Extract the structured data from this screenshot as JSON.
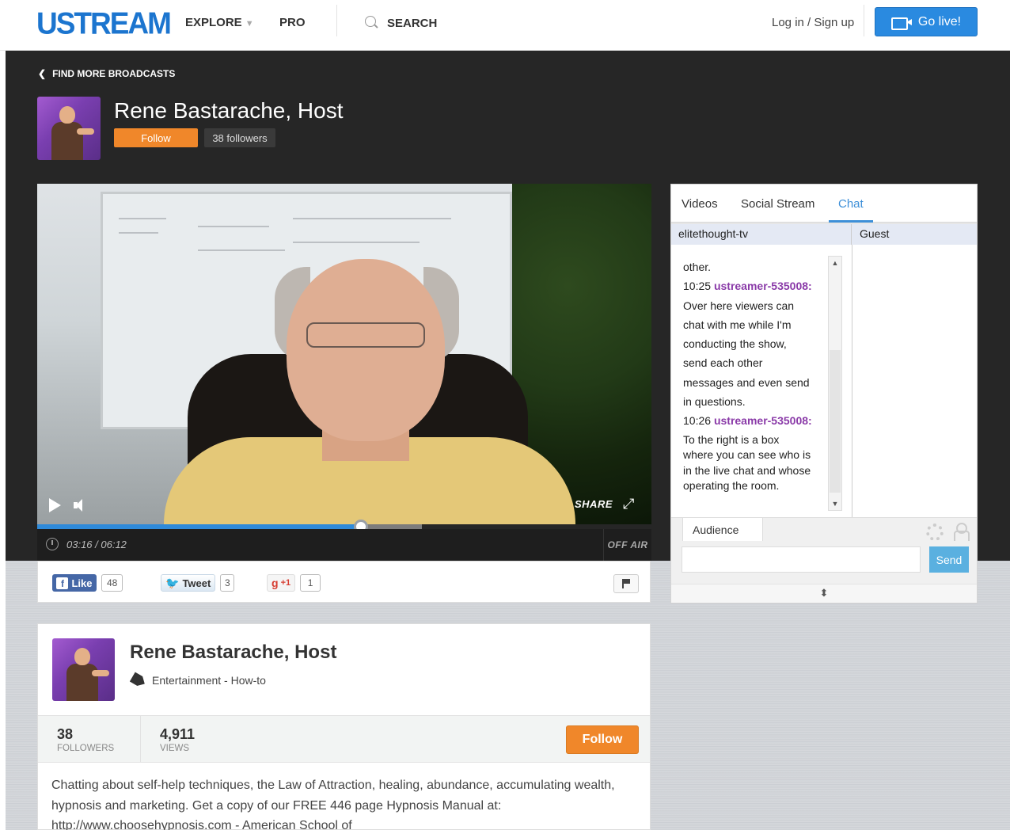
{
  "nav": {
    "logo": "USTREAM",
    "explore": "EXPLORE",
    "explore_chevron": "▼",
    "pro": "PRO",
    "search": "SEARCH",
    "login": "Log in / Sign up",
    "go_live": "Go live!"
  },
  "header": {
    "find_more": "FIND MORE BROADCASTS",
    "host_name": "Rene Bastarache, Host",
    "follow": "Follow",
    "followers": "38 followers"
  },
  "player": {
    "share": "SHARE",
    "time": "03:16 / 06:12",
    "status": "OFF AIR",
    "progress_fraction": 0.527,
    "buffered_fraction": 0.626
  },
  "social": {
    "like": "Like",
    "like_count": "48",
    "tweet": "Tweet",
    "tweet_count": "3",
    "plus_one": "+1",
    "plus_count": "1"
  },
  "chat": {
    "tabs": [
      "Videos",
      "Social Stream",
      "Chat"
    ],
    "active_tab": "Chat",
    "room_name": "elitethought-tv",
    "guest_label": "Guest",
    "messages": {
      "line0": "other.",
      "t1": "10:25",
      "u1": "ustreamer-535008:",
      "m1a": "Over here viewers can",
      "m1b": "chat with me while I'm",
      "m1c": "conducting the show,",
      "m1d": "send each other",
      "m1e": "messages and even send",
      "m1f": "in questions.",
      "t2": "10:26",
      "u2": "ustreamer-535008:",
      "m2a": "To the right is a box",
      "m2b": "where you can see who is",
      "m2c": "in the live chat and whose",
      "m2d": "operating the room."
    },
    "audience_tab": "Audience",
    "send": "Send",
    "input_value": ""
  },
  "info": {
    "title": "Rene Bastarache, Host",
    "category": "Entertainment - How-to",
    "followers_num": "38",
    "followers_label": "FOLLOWERS",
    "views_num": "4,911",
    "views_label": "VIEWS",
    "follow": "Follow",
    "description": "Chatting about self-help techniques, the Law of Attraction, healing, abundance, accumulating wealth, hypnosis and marketing. Get a copy of our FREE 446 page Hypnosis Manual at: http://www.choosehypnosis.com - American School of"
  },
  "colors": {
    "brand_blue": "#1c75cf",
    "go_live_blue": "#2a8ae0",
    "follow_orange": "#f0872a",
    "chat_user_purple": "#8a3aa8",
    "progress_blue": "#2f8ad9"
  },
  "icons": [
    "search-icon",
    "camera-icon",
    "chevron-left-icon",
    "play-icon",
    "volume-icon",
    "expand-icon",
    "clock-icon",
    "facebook-icon",
    "twitter-bird-icon",
    "google-plus-icon",
    "flag-icon",
    "gear-icon",
    "user-icon",
    "tag-icon",
    "resize-icon"
  ]
}
